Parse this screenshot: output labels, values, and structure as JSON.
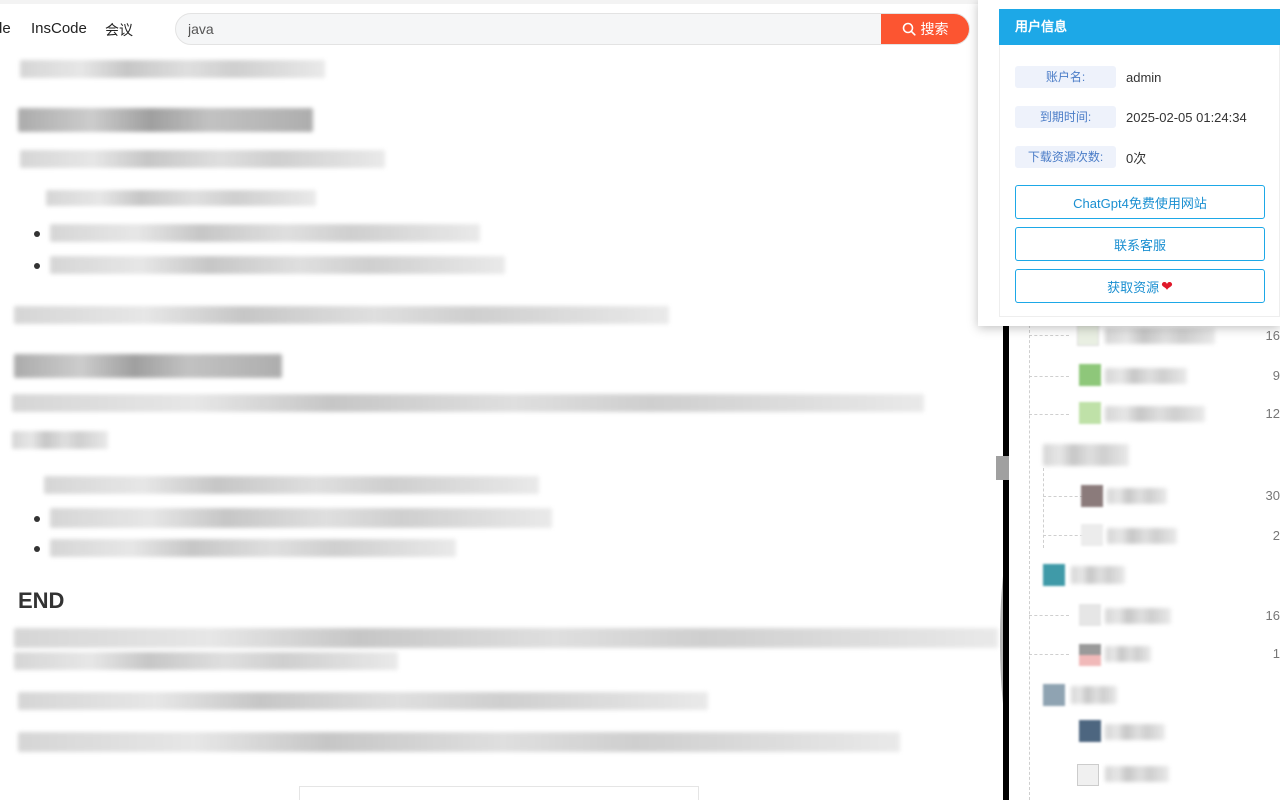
{
  "nav": {
    "cut_link": "de",
    "inscode": "InsCode",
    "meeting": "会议"
  },
  "search": {
    "value": "java",
    "button_label": "搜索"
  },
  "article": {
    "end_heading": "END"
  },
  "user_panel": {
    "title": "用户信息",
    "rows": [
      {
        "label": "账户名:",
        "value": "admin"
      },
      {
        "label": "到期时间:",
        "value": "2025-02-05 01:24:34"
      },
      {
        "label": "下载资源次数:",
        "value": "0次"
      }
    ],
    "buttons": {
      "chatgpt": "ChatGpt4免费使用网站",
      "contact": "联系客服",
      "get_resource": "获取资源"
    }
  },
  "sidebar": {
    "counts": [
      "16",
      "9",
      "12",
      "30",
      "2",
      "16",
      "1"
    ]
  },
  "colors": {
    "search_button": "#fc5531",
    "panel_header": "#1da8e7",
    "button_border": "#1da8e7",
    "heart": "#e0182a"
  }
}
